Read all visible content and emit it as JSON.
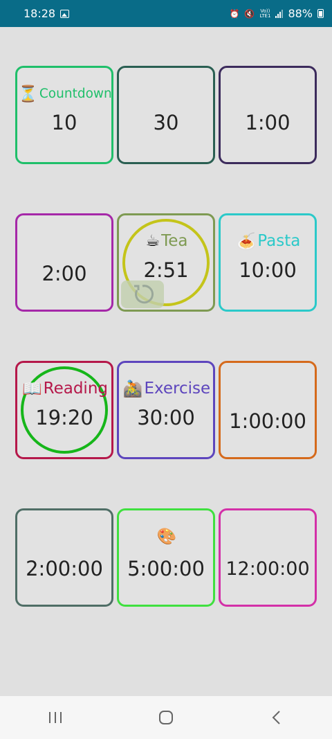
{
  "status_bar": {
    "time": "18:28",
    "battery": "88%",
    "network": "Vo)) LTE1",
    "icons": [
      "photo-icon",
      "alarm-icon",
      "mute-icon",
      "signal-icon",
      "battery-icon"
    ]
  },
  "timers": [
    {
      "label": "Countdown",
      "emoji": "⏳",
      "time": "10",
      "color": "#1fbf6a"
    },
    {
      "label": "",
      "emoji": "",
      "time": "30",
      "color": "#2a5f52"
    },
    {
      "label": "",
      "emoji": "",
      "time": "1:00",
      "color": "#3c2b5c"
    },
    {
      "label": "",
      "emoji": "",
      "time": "2:00",
      "color": "#a528a8"
    },
    {
      "label": "Tea",
      "emoji": "☕",
      "time": "2:51",
      "color": "#7e9a52",
      "running": true,
      "progress_ring_color": "#c4c41a"
    },
    {
      "label": "Pasta",
      "emoji": "🍝",
      "time": "10:00",
      "color": "#2bc9c9"
    },
    {
      "label": "Reading",
      "emoji": "📖",
      "time": "19:20",
      "color": "#b5184a",
      "running": true,
      "progress_ring_color": "#16b61a"
    },
    {
      "label": "Exercise",
      "emoji": "🚵",
      "time": "30:00",
      "color": "#5d45bd"
    },
    {
      "label": "",
      "emoji": "",
      "time": "1:00:00",
      "color": "#d56a1c"
    },
    {
      "label": "",
      "emoji": "",
      "time": "2:00:00",
      "color": "#4f6e66"
    },
    {
      "label": "",
      "emoji": "🎨",
      "time": "5:00:00",
      "color": "#3fe03f"
    },
    {
      "label": "",
      "emoji": "",
      "time": "12:00:00",
      "color": "#d330a8"
    }
  ],
  "tea_reset_icon": "reset-icon",
  "nav": {
    "icons": [
      "recent-apps-icon",
      "home-icon",
      "back-icon"
    ]
  }
}
